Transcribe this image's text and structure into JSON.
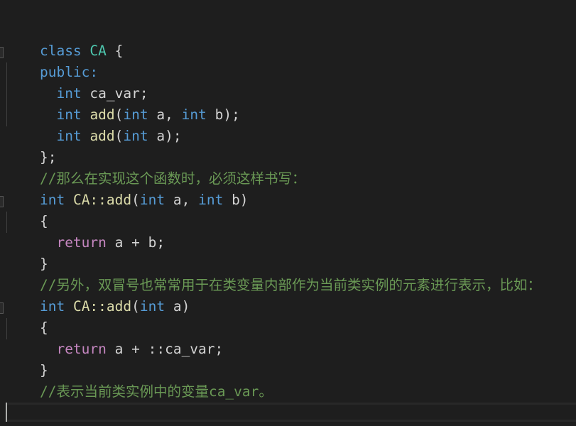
{
  "editor": {
    "theme_colors": {
      "background": "#1e1e1e",
      "keyword": "#569cd6",
      "type": "#4ec9b0",
      "function": "#dcdcaa",
      "control": "#c586c0",
      "text": "#d4d4d4",
      "comment": "#6a9955"
    },
    "lines": [
      {
        "tokens": [
          "class",
          " ",
          "CA",
          " {"
        ]
      },
      {
        "tokens": [
          "public:"
        ]
      },
      {
        "tokens": [
          "  ",
          "int",
          " ca_var;"
        ]
      },
      {
        "tokens": [
          "  ",
          "int",
          " ",
          "add",
          "(",
          "int",
          " a, ",
          "int",
          " b);"
        ]
      },
      {
        "tokens": [
          "  ",
          "int",
          " ",
          "add",
          "(",
          "int",
          " a);"
        ]
      },
      {
        "tokens": [
          "};"
        ]
      },
      {
        "tokens": [
          "//那么在实现这个函数时，必须这样书写："
        ]
      },
      {
        "tokens": [
          "int",
          " ",
          "CA::add",
          "(",
          "int",
          " a, ",
          "int",
          " b)"
        ]
      },
      {
        "tokens": [
          "{"
        ]
      },
      {
        "tokens": [
          "  ",
          "return",
          " a + b;"
        ]
      },
      {
        "tokens": [
          "}"
        ]
      },
      {
        "tokens": [
          "//另外，双冒号也常常用于在类变量内部作为当前类实例的元素进行表示，比如："
        ]
      },
      {
        "tokens": [
          "int",
          " ",
          "CA::add",
          "(",
          "int",
          " a)"
        ]
      },
      {
        "tokens": [
          "{"
        ]
      },
      {
        "tokens": [
          "  ",
          "return",
          " a + ::ca_var;"
        ]
      },
      {
        "tokens": [
          "}"
        ]
      },
      {
        "tokens": [
          "//表示当前类实例中的变量ca_var。"
        ]
      },
      {
        "tokens": [
          ""
        ]
      },
      {
        "tokens": [
          ""
        ]
      }
    ]
  }
}
